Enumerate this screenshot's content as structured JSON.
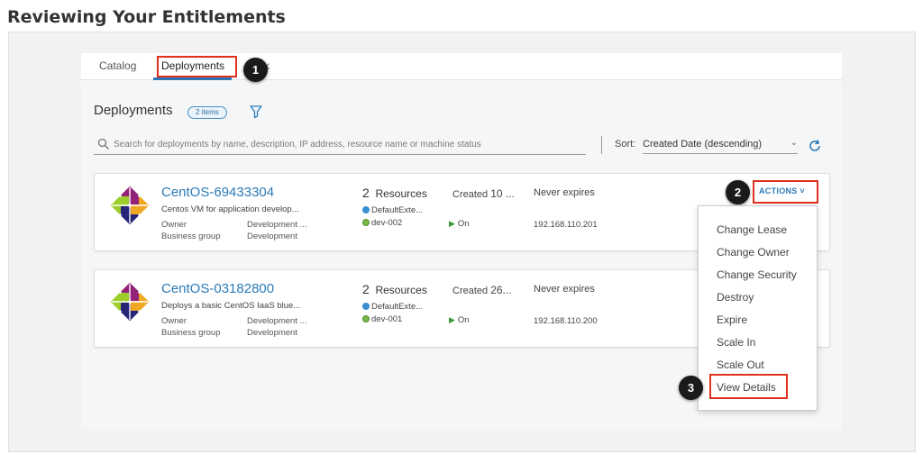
{
  "page": {
    "title": "Reviewing Your Entitlements"
  },
  "tabs": [
    {
      "label": "Catalog"
    },
    {
      "label": "Deployments"
    },
    {
      "label": "x"
    }
  ],
  "section": {
    "title": "Deployments",
    "count_badge": "2 items"
  },
  "search": {
    "placeholder": "Search for deployments by name, description, IP address, resource name or machine status"
  },
  "sort": {
    "label": "Sort:",
    "value": "Created Date (descending)"
  },
  "deployments": [
    {
      "name": "CentOS-69433304",
      "description": "Centos VM for application develop...",
      "owner_label": "Owner",
      "owner_value": "Development ...",
      "group_label": "Business group",
      "group_value": "Development",
      "resources_count": "2",
      "resources_label": "Resources",
      "resource_1": "DefaultExte...",
      "resource_2": "dev-002",
      "created_label": "Created",
      "created_value": "10 ...",
      "power": "On",
      "expires": "Never expires",
      "ip": "192.168.110.201"
    },
    {
      "name": "CentOS-03182800",
      "description": "Deploys a basic CentOS IaaS blue...",
      "owner_label": "Owner",
      "owner_value": "Development ...",
      "group_label": "Business group",
      "group_value": "Development",
      "resources_count": "2",
      "resources_label": "Resources",
      "resource_1": "DefaultExte...",
      "resource_2": "dev-001",
      "created_label": "Created",
      "created_value": "26...",
      "power": "On",
      "expires": "Never expires",
      "ip": "192.168.110.200"
    }
  ],
  "actions": {
    "button_label": "ACTIONS",
    "menu": [
      "Change Lease",
      "Change Owner",
      "Change Security",
      "Destroy",
      "Expire",
      "Scale In",
      "Scale Out",
      "View Details"
    ]
  },
  "callouts": [
    "1",
    "2",
    "3"
  ],
  "colors": {
    "accent": "#2a7ab8",
    "highlight_box": "#e0301e",
    "callout_bg": "#1a1a1a",
    "status_on": "#3a9a3a"
  }
}
